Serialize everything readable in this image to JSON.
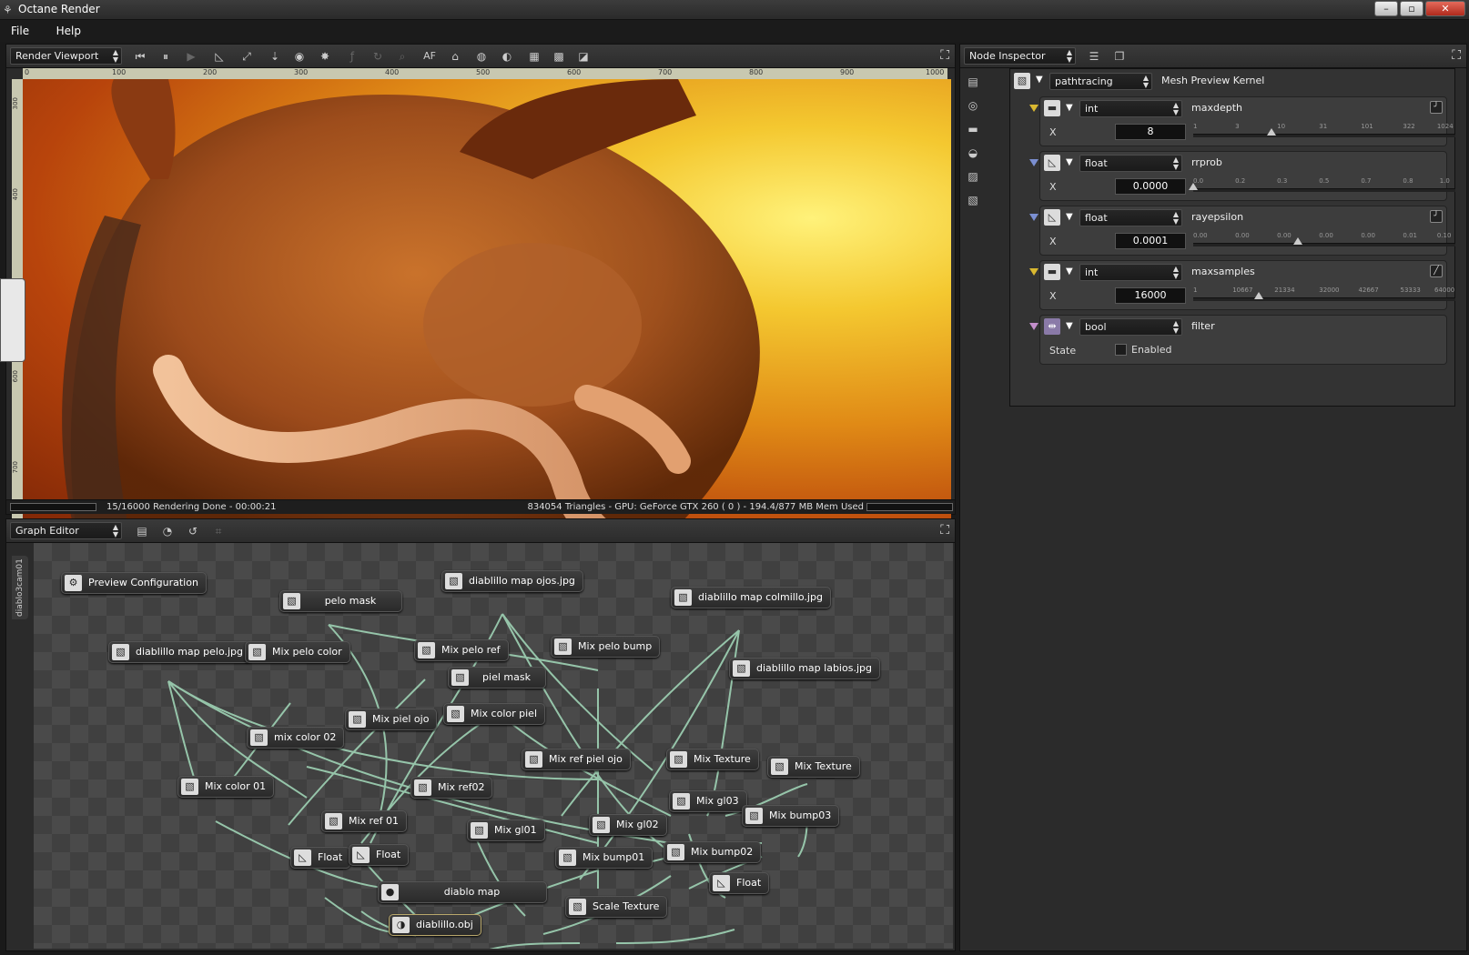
{
  "window": {
    "title": "Octane Render"
  },
  "menu": [
    "File",
    "Help"
  ],
  "viewport": {
    "combo": "Render Viewport",
    "ruler_h": [
      "0",
      "100",
      "200",
      "300",
      "400",
      "500",
      "600",
      "700",
      "800",
      "900",
      "1000"
    ],
    "ruler_v": [
      "300",
      "400",
      "500",
      "600",
      "700"
    ],
    "status_left": "15/16000 Rendering Done - 00:00:21",
    "status_right": "834054 Triangles - GPU: GeForce GTX 260 ( 0 ) - 194.4/877 MB Mem Used",
    "toolbar_text": {
      "af": "AF"
    }
  },
  "graph_editor": {
    "combo": "Graph Editor",
    "tab": "diablo3cam01",
    "nodes": [
      {
        "label": "Preview Configuration"
      },
      {
        "label": "pelo mask"
      },
      {
        "label": "diablillo map ojos.jpg"
      },
      {
        "label": "diablillo map colmillo.jpg"
      },
      {
        "label": "diablillo map pelo.jpg"
      },
      {
        "label": "Mix pelo color"
      },
      {
        "label": "Mix pelo ref"
      },
      {
        "label": "Mix pelo bump"
      },
      {
        "label": "piel mask"
      },
      {
        "label": "diablillo map labios.jpg"
      },
      {
        "label": "Mix piel ojo"
      },
      {
        "label": "Mix color piel"
      },
      {
        "label": "mix color 02"
      },
      {
        "label": "Mix ref piel ojo"
      },
      {
        "label": "Mix Texture"
      },
      {
        "label": "Mix Texture"
      },
      {
        "label": "Mix color 01"
      },
      {
        "label": "Mix ref02"
      },
      {
        "label": "Mix gl03"
      },
      {
        "label": "Mix ref 01"
      },
      {
        "label": "Mix gl01"
      },
      {
        "label": "Mix gl02"
      },
      {
        "label": "Mix bump03"
      },
      {
        "label": "Float"
      },
      {
        "label": "Float"
      },
      {
        "label": "Mix bump01"
      },
      {
        "label": "Mix bump02"
      },
      {
        "label": "diablo map"
      },
      {
        "label": "Float"
      },
      {
        "label": "Scale Texture"
      },
      {
        "label": "diablillo.obj"
      }
    ]
  },
  "inspector": {
    "combo": "Node Inspector",
    "kernel_combo": "pathtracing",
    "kernel_name": "Mesh Preview Kernel",
    "params": [
      {
        "type": "int",
        "name": "maxdepth",
        "label": "X",
        "value": "8",
        "ticks": [
          "1",
          "3",
          "10",
          "31",
          "101",
          "322",
          "1024"
        ],
        "thumb": 0.3
      },
      {
        "type": "float",
        "name": "rrprob",
        "label": "X",
        "value": "0.0000",
        "ticks": [
          "0.0",
          "0.2",
          "0.3",
          "0.5",
          "0.7",
          "0.8",
          "1.0"
        ],
        "thumb": 0.0
      },
      {
        "type": "float",
        "name": "rayepsilon",
        "label": "X",
        "value": "0.0001",
        "ticks": [
          "0.00",
          "0.00",
          "0.00",
          "0.00",
          "0.00",
          "0.01",
          "0.10"
        ],
        "thumb": 0.4
      },
      {
        "type": "int",
        "name": "maxsamples",
        "label": "X",
        "value": "16000",
        "ticks": [
          "1",
          "10667",
          "21334",
          "32000",
          "42667",
          "53333",
          "64000"
        ],
        "thumb": 0.25
      },
      {
        "type": "bool",
        "name": "filter",
        "label": "State",
        "value": "Enabled"
      }
    ]
  },
  "colors": {
    "accent_pin": "#d9b830",
    "wire": "#9fd3b5",
    "panel": "#2b2b2b"
  }
}
